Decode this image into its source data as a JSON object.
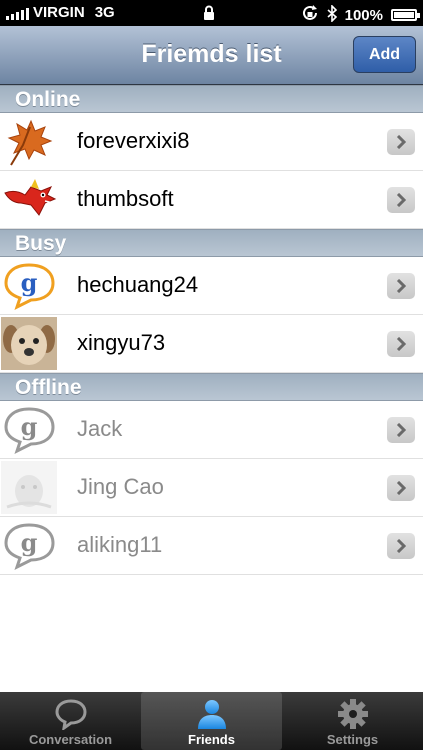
{
  "status": {
    "carrier": "VIRGIN",
    "network": "3G",
    "battery": "100%"
  },
  "navbar": {
    "title": "Friemds list",
    "add_label": "Add"
  },
  "sections": [
    {
      "title": "Online",
      "friends": [
        {
          "name": "foreverxixi8",
          "avatar": "maple-leaf-icon"
        },
        {
          "name": "thumbsoft",
          "avatar": "red-dragon-icon"
        }
      ]
    },
    {
      "title": "Busy",
      "friends": [
        {
          "name": "hechuang24",
          "avatar": "gtalk-bubble-icon"
        },
        {
          "name": "xingyu73",
          "avatar": "puppy-photo"
        }
      ]
    },
    {
      "title": "Offline",
      "friends": [
        {
          "name": "Jack",
          "avatar": "gtalk-bubble-gray-icon"
        },
        {
          "name": "Jing Cao",
          "avatar": "faded-photo"
        },
        {
          "name": "aliking11",
          "avatar": "gtalk-bubble-gray-icon"
        }
      ]
    }
  ],
  "tabs": [
    {
      "label": "Conversation",
      "icon": "speech-bubble-icon",
      "active": false
    },
    {
      "label": "Friends",
      "icon": "person-icon",
      "active": true
    },
    {
      "label": "Settings",
      "icon": "gear-icon",
      "active": false
    }
  ],
  "colors": {
    "nav_top": "#b3c2d6",
    "nav_bottom": "#6d84a2",
    "add_button": "#3a68b2",
    "offline_text": "#8a8a8a"
  }
}
